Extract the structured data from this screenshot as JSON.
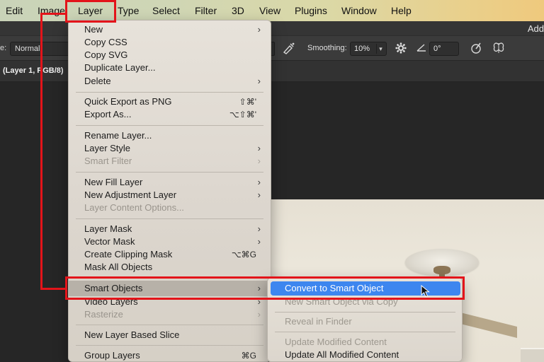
{
  "menubar": {
    "items": [
      {
        "label": "Edit"
      },
      {
        "label": "Image"
      },
      {
        "label": "Layer"
      },
      {
        "label": "Type"
      },
      {
        "label": "Select"
      },
      {
        "label": "Filter"
      },
      {
        "label": "3D"
      },
      {
        "label": "View"
      },
      {
        "label": "Plugins"
      },
      {
        "label": "Window"
      },
      {
        "label": "Help"
      }
    ]
  },
  "titlestrip": {
    "text": "Add"
  },
  "options": {
    "mode_label": "e:",
    "mode_value": "Normal",
    "smoothing_label": "Smoothing:",
    "smoothing_value": "10%",
    "angle_value": "0°"
  },
  "doc_tab": {
    "label": "(Layer 1, RGB/8)"
  },
  "layer_menu": {
    "items": [
      {
        "label": "New",
        "submenu": true
      },
      {
        "label": "Copy CSS"
      },
      {
        "label": "Copy SVG"
      },
      {
        "label": "Duplicate Layer..."
      },
      {
        "label": "Delete",
        "submenu": true
      },
      {
        "label": "Quick Export as PNG",
        "shortcut": "⇧⌘'"
      },
      {
        "label": "Export As...",
        "shortcut": "⌥⇧⌘'"
      },
      {
        "label": "Rename Layer..."
      },
      {
        "label": "Layer Style",
        "submenu": true
      },
      {
        "label": "Smart Filter",
        "submenu": true,
        "disabled": true
      },
      {
        "label": "New Fill Layer",
        "submenu": true
      },
      {
        "label": "New Adjustment Layer",
        "submenu": true
      },
      {
        "label": "Layer Content Options...",
        "disabled": true
      },
      {
        "label": "Layer Mask",
        "submenu": true
      },
      {
        "label": "Vector Mask",
        "submenu": true
      },
      {
        "label": "Create Clipping Mask",
        "shortcut": "⌥⌘G"
      },
      {
        "label": "Mask All Objects"
      },
      {
        "label": "Smart Objects",
        "submenu": true,
        "highlighted": true
      },
      {
        "label": "Video Layers",
        "submenu": true
      },
      {
        "label": "Rasterize",
        "submenu": true,
        "disabled": true
      },
      {
        "label": "New Layer Based Slice"
      },
      {
        "label": "Group Layers",
        "shortcut": "⌘G"
      }
    ]
  },
  "smart_objects_submenu": {
    "items": [
      {
        "label": "Convert to Smart Object",
        "selected": true
      },
      {
        "label": "New Smart Object via Copy",
        "disabled": true
      },
      {
        "label": "Reveal in Finder",
        "disabled": true
      },
      {
        "label": "Update Modified Content",
        "disabled": true
      },
      {
        "label": "Update All Modified Content"
      }
    ]
  },
  "colors": {
    "annotation_red": "#e3141a",
    "selection_blue": "#3d86ef"
  }
}
